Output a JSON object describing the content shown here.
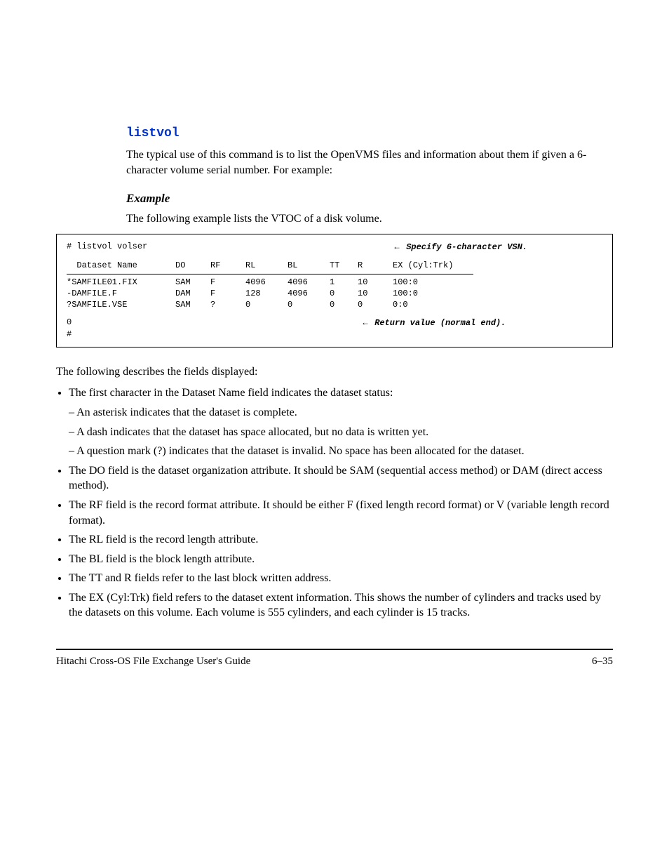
{
  "heading": "listvol",
  "intro": "The typical use of this command is to list the OpenVMS files and information about them if given a 6-character volume serial number. For example:",
  "example_header": "Example",
  "example_desc": "The following example lists the VTOC of a disk volume.",
  "code": {
    "cmd_prefix": "# ",
    "cmd": "listvol volser",
    "cmd_note": "Specify 6-character VSN.",
    "columns": [
      "Dataset Name",
      "DO",
      "RF",
      "RL",
      "BL",
      "TT",
      "R",
      "EX (Cyl:Trk)"
    ],
    "rows": [
      [
        "*SAMFILE01.FIX",
        "SAM",
        "F",
        "4096",
        "4096",
        "1",
        "10",
        "100:0"
      ],
      [
        "-DAMFILE.F",
        "DAM",
        "F",
        "128",
        "4096",
        "0",
        "10",
        "100:0"
      ],
      [
        "?SAMFILE.VSE",
        "SAM",
        "?",
        "0",
        "0",
        "0",
        "0",
        "0:0"
      ]
    ],
    "ret": "0",
    "ret_note": "Return value (normal end).",
    "final": "#"
  },
  "explanation": "The following describes the fields displayed:",
  "list1": [
    {
      "text": "The first character in the Dataset Name field indicates the dataset status:",
      "subitems": [
        "– An asterisk indicates that the dataset is complete.",
        "– A dash indicates that the dataset has space allocated, but no data is written yet.",
        "– A question mark (?) indicates that the dataset is invalid. No space has been allocated for the dataset."
      ]
    },
    {
      "text": "The DO field is the dataset organization attribute. It should be SAM (sequential access method) or DAM (direct access method)."
    },
    {
      "text": "The RF field is the record format attribute. It should be either F (fixed length record format) or V (variable length record format)."
    },
    {
      "text": "The RL field is the record length attribute."
    },
    {
      "text": "The BL field is the block length attribute."
    },
    {
      "text": "The TT and R fields refer to the last block written address."
    },
    {
      "text": "The EX (Cyl:Trk) field refers to the dataset extent information. This shows the number of cylinders and tracks used by the datasets on this volume. Each volume is 555 cylinders, and each cylinder is 15 tracks."
    }
  ],
  "footer_left": "Hitachi Cross-OS File Exchange User's Guide",
  "footer_right": "6–35"
}
